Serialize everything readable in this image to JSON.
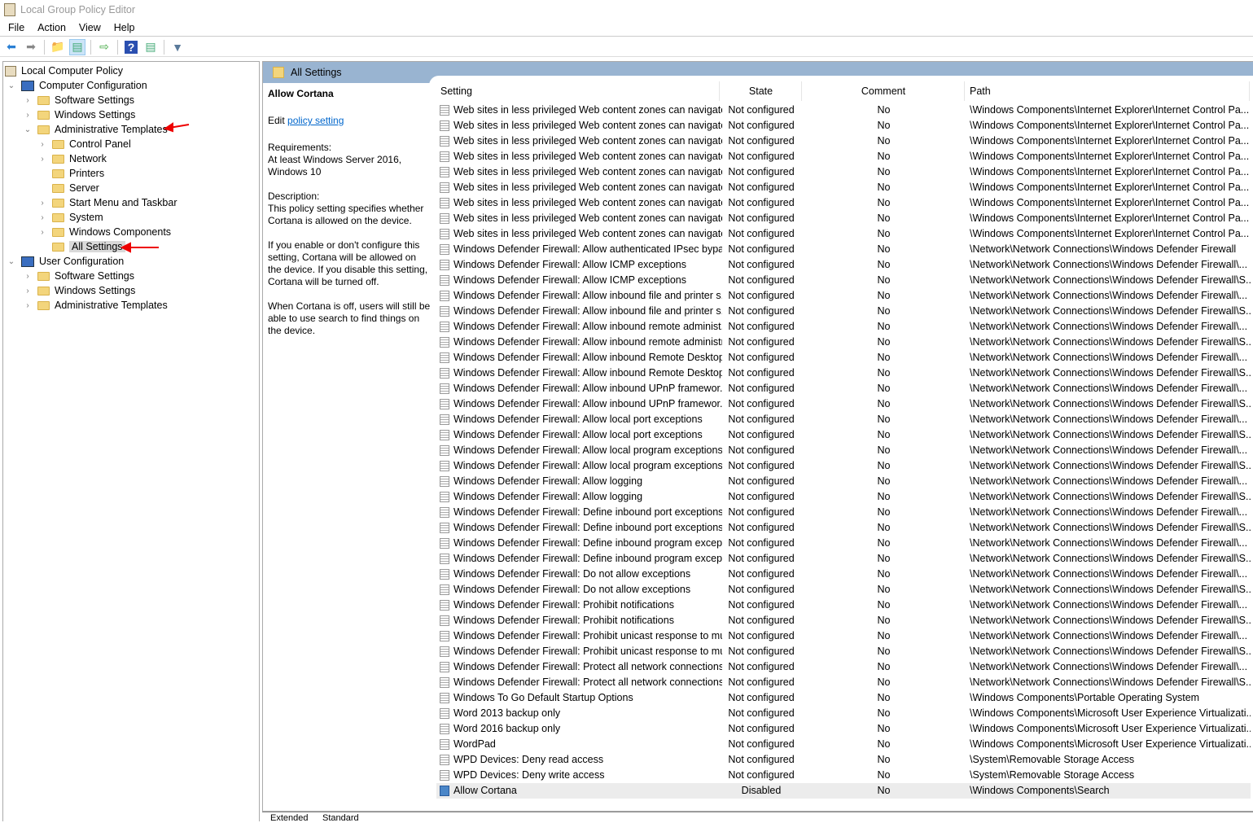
{
  "window": {
    "title": "Local Group Policy Editor"
  },
  "menu": [
    "File",
    "Action",
    "View",
    "Help"
  ],
  "toolbar": [
    "back-icon",
    "forward-icon",
    "up-folder-icon",
    "show-hide-tree-icon",
    "export-list-icon",
    "help-icon",
    "show-hide-action-pane-icon",
    "filter-icon"
  ],
  "tree": [
    {
      "label": "Local Computer Policy",
      "level": 0,
      "icon": "scroll",
      "chev": ""
    },
    {
      "label": "Computer Configuration",
      "level": 0,
      "icon": "pc",
      "chev": "v"
    },
    {
      "label": "Software Settings",
      "level": 1,
      "icon": "folder",
      "chev": ">"
    },
    {
      "label": "Windows Settings",
      "level": 1,
      "icon": "folder",
      "chev": ">"
    },
    {
      "label": "Administrative Templates",
      "level": 1,
      "icon": "folder",
      "chev": "v"
    },
    {
      "label": "Control Panel",
      "level": 2,
      "icon": "folder",
      "chev": ">"
    },
    {
      "label": "Network",
      "level": 2,
      "icon": "folder",
      "chev": ">"
    },
    {
      "label": "Printers",
      "level": 2,
      "icon": "folder",
      "chev": ""
    },
    {
      "label": "Server",
      "level": 2,
      "icon": "folder",
      "chev": ""
    },
    {
      "label": "Start Menu and Taskbar",
      "level": 2,
      "icon": "folder",
      "chev": ">"
    },
    {
      "label": "System",
      "level": 2,
      "icon": "folder",
      "chev": ">"
    },
    {
      "label": "Windows Components",
      "level": 2,
      "icon": "folder",
      "chev": ">"
    },
    {
      "label": "All Settings",
      "level": 2,
      "icon": "folder",
      "chev": "",
      "selected": true
    },
    {
      "label": "User Configuration",
      "level": 0,
      "icon": "pc",
      "chev": "v"
    },
    {
      "label": "Software Settings",
      "level": 1,
      "icon": "folder",
      "chev": ">"
    },
    {
      "label": "Windows Settings",
      "level": 1,
      "icon": "folder",
      "chev": ">"
    },
    {
      "label": "Administrative Templates",
      "level": 1,
      "icon": "folder",
      "chev": ">"
    }
  ],
  "pane": {
    "title": "All Settings"
  },
  "details": {
    "heading": "Allow Cortana",
    "edit_prefix": "Edit",
    "edit_link": "policy setting",
    "requirements": "Requirements:\nAt least Windows Server 2016, Windows 10",
    "description": "Description:\nThis policy setting specifies whether Cortana is allowed on the device.",
    "para1": "If you enable or don't configure this setting, Cortana will be allowed on the device. If you disable this setting, Cortana will be turned off.",
    "para2": "When Cortana is off, users will still be able to use search to find things on the device."
  },
  "columns": {
    "setting": "Setting",
    "state": "State",
    "comment": "Comment",
    "path": "Path"
  },
  "rows": [],
  "tabs": [
    "Extended",
    "Standard"
  ]
}
